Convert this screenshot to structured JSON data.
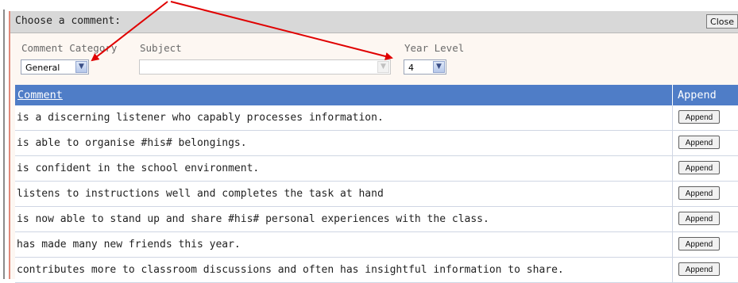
{
  "dialog": {
    "title": "Choose a comment:",
    "close_label": "Close"
  },
  "filters": {
    "category_label": "Comment Category",
    "category_value": "General",
    "subject_label": "Subject",
    "subject_value": "",
    "year_label": "Year Level",
    "year_value": "4"
  },
  "table": {
    "col_comment": "Comment",
    "col_append": "Append",
    "rows": [
      {
        "comment": "is a discerning listener who capably processes information.",
        "button": "Append"
      },
      {
        "comment": "is able to organise #his# belongings.",
        "button": "Append"
      },
      {
        "comment": "is confident in the school environment.",
        "button": "Append"
      },
      {
        "comment": "listens to instructions well and completes the task at hand",
        "button": "Append"
      },
      {
        "comment": "is now able to stand up and share #his# personal experiences with the class.",
        "button": "Append"
      },
      {
        "comment": "has made many new friends this year.",
        "button": "Append"
      },
      {
        "comment": "contributes more to classroom discussions and often has insightful information to share.",
        "button": "Append"
      }
    ]
  },
  "colors": {
    "header_blue": "#4f7dc7",
    "annotation_arrow": "#e00000"
  },
  "icons": [
    "chevron-down-icon"
  ]
}
